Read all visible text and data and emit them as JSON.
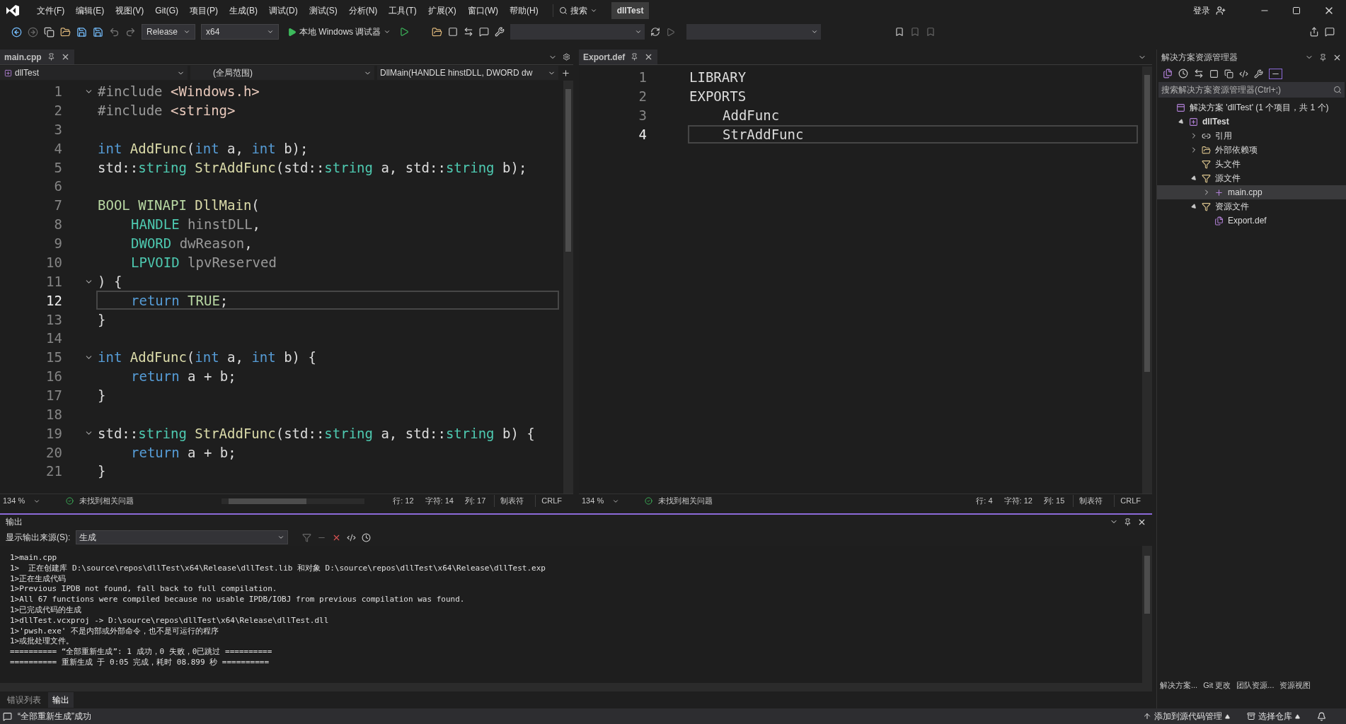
{
  "menu": [
    "文件(F)",
    "编辑(E)",
    "视图(V)",
    "Git(G)",
    "项目(P)",
    "生成(B)",
    "调试(D)",
    "测试(S)",
    "分析(N)",
    "工具(T)",
    "扩展(X)",
    "窗口(W)",
    "帮助(H)"
  ],
  "search": "搜索",
  "solution_badge": "dllTest",
  "account": "登录",
  "toolbar": {
    "configuration": "Release",
    "platform": "x64",
    "debugger": "本地 Windows 调试器"
  },
  "editors": [
    {
      "tab": "main.cpp",
      "nav": [
        "dllTest",
        "(全局范围)",
        "DllMain(HANDLE hinstDLL, DWORD dw"
      ],
      "lines": [
        {
          "number": "1",
          "fold": true,
          "current": false,
          "indented": false,
          "tokens": [
            {
              "text": "#include",
              "kind": "pre"
            },
            {
              "text": " <Windows.h>",
              "kind": "str"
            }
          ]
        },
        {
          "number": "2",
          "fold": false,
          "current": false,
          "indented": false,
          "tokens": [
            {
              "text": "#include",
              "kind": "pre"
            },
            {
              "text": " <string>",
              "kind": "str"
            }
          ]
        },
        {
          "number": "3",
          "fold": false,
          "current": false
        },
        {
          "number": "4",
          "fold": false,
          "current": false,
          "indented": false,
          "tokens": [
            {
              "text": "int",
              "kind": "kw"
            },
            {
              "text": " AddFunc",
              "kind": "fn"
            },
            {
              "text": "(",
              "kind": "plain"
            },
            {
              "text": "int",
              "kind": "kw"
            },
            {
              "text": " a, ",
              "kind": "plain"
            },
            {
              "text": "int",
              "kind": "kw"
            },
            {
              "text": " b);",
              "kind": "plain"
            }
          ]
        },
        {
          "number": "5",
          "fold": false,
          "current": false,
          "indented": false,
          "tokens": [
            {
              "text": "std::",
              "kind": "plain"
            },
            {
              "text": "string",
              "kind": "type"
            },
            {
              "text": " StrAddFunc",
              "kind": "fn"
            },
            {
              "text": "(std::",
              "kind": "plain"
            },
            {
              "text": "string",
              "kind": "type"
            },
            {
              "text": " a, std::",
              "kind": "plain"
            },
            {
              "text": "string",
              "kind": "type"
            },
            {
              "text": " b);",
              "kind": "plain"
            }
          ]
        },
        {
          "number": "6",
          "fold": false,
          "current": false
        },
        {
          "number": "7",
          "fold": false,
          "current": false,
          "indented": false,
          "tokens": [
            {
              "text": "BOOL",
              "kind": "macro"
            },
            {
              "text": " WINAPI",
              "kind": "macro"
            },
            {
              "text": " DllMain",
              "kind": "fn"
            },
            {
              "text": "(",
              "kind": "plain"
            }
          ]
        },
        {
          "number": "8",
          "fold": false,
          "current": false,
          "indented": true,
          "tokens": [
            {
              "text": "HANDLE",
              "kind": "type"
            },
            {
              "text": " hinstDLL",
              "kind": "param"
            },
            {
              "text": ",",
              "kind": "plain"
            }
          ]
        },
        {
          "number": "9",
          "fold": false,
          "current": false,
          "indented": true,
          "tokens": [
            {
              "text": "DWORD",
              "kind": "type"
            },
            {
              "text": " dwReason",
              "kind": "param"
            },
            {
              "text": ",",
              "kind": "plain"
            }
          ]
        },
        {
          "number": "10",
          "fold": false,
          "current": false,
          "indented": true,
          "tokens": [
            {
              "text": "LPVOID",
              "kind": "type"
            },
            {
              "text": " lpvReserved",
              "kind": "param"
            }
          ]
        },
        {
          "number": "11",
          "fold": true,
          "current": false,
          "indented": false,
          "tokens": [
            {
              "text": ") {",
              "kind": "plain"
            }
          ]
        },
        {
          "number": "12",
          "fold": false,
          "current": true,
          "indented": true,
          "tokens": [
            {
              "text": "return",
              "kind": "kw"
            },
            {
              "text": " TRUE",
              "kind": "macro"
            },
            {
              "text": ";",
              "kind": "plain"
            }
          ]
        },
        {
          "number": "13",
          "fold": false,
          "current": false,
          "indented": false,
          "tokens": [
            {
              "text": "}",
              "kind": "plain"
            }
          ]
        },
        {
          "number": "14",
          "fold": false,
          "current": false
        },
        {
          "number": "15",
          "fold": true,
          "current": false,
          "indented": false,
          "tokens": [
            {
              "text": "int",
              "kind": "kw"
            },
            {
              "text": " AddFunc",
              "kind": "fn"
            },
            {
              "text": "(",
              "kind": "plain"
            },
            {
              "text": "int",
              "kind": "kw"
            },
            {
              "text": " a, ",
              "kind": "plain"
            },
            {
              "text": "int",
              "kind": "kw"
            },
            {
              "text": " b) {",
              "kind": "plain"
            }
          ]
        },
        {
          "number": "16",
          "fold": false,
          "current": false,
          "indented": true,
          "tokens": [
            {
              "text": "return",
              "kind": "kw"
            },
            {
              "text": " a + b;",
              "kind": "plain"
            }
          ]
        },
        {
          "number": "17",
          "fold": false,
          "current": false,
          "indented": false,
          "tokens": [
            {
              "text": "}",
              "kind": "plain"
            }
          ]
        },
        {
          "number": "18",
          "fold": false,
          "current": false
        },
        {
          "number": "19",
          "fold": true,
          "current": false,
          "indented": false,
          "tokens": [
            {
              "text": "std::",
              "kind": "plain"
            },
            {
              "text": "string",
              "kind": "type"
            },
            {
              "text": " StrAddFunc",
              "kind": "fn"
            },
            {
              "text": "(std::",
              "kind": "plain"
            },
            {
              "text": "string",
              "kind": "type"
            },
            {
              "text": " a, std::",
              "kind": "plain"
            },
            {
              "text": "string",
              "kind": "type"
            },
            {
              "text": " b) {",
              "kind": "plain"
            }
          ]
        },
        {
          "number": "20",
          "fold": false,
          "current": false,
          "indented": true,
          "tokens": [
            {
              "text": "return",
              "kind": "kw"
            },
            {
              "text": " a + b;",
              "kind": "plain"
            }
          ]
        },
        {
          "number": "21",
          "fold": false,
          "current": false,
          "indented": false,
          "tokens": [
            {
              "text": "}",
              "kind": "plain"
            }
          ]
        }
      ],
      "status": {
        "zoom": "134 %",
        "issues": "未找到相关问题",
        "position": [
          "行: 12",
          "字符: 14",
          "列: 17"
        ],
        "indent": "制表符",
        "eol": "CRLF"
      }
    },
    {
      "tab": "Export.def",
      "lines": [
        {
          "number": "1",
          "fold": false,
          "current": false,
          "indented": false,
          "tokens": [
            {
              "text": "LIBRARY",
              "kind": "plain"
            }
          ]
        },
        {
          "number": "2",
          "fold": false,
          "current": false,
          "indented": false,
          "tokens": [
            {
              "text": "EXPORTS",
              "kind": "plain"
            }
          ]
        },
        {
          "number": "3",
          "fold": false,
          "current": false,
          "indented": true,
          "tokens": [
            {
              "text": "AddFunc",
              "kind": "plain"
            }
          ]
        },
        {
          "number": "4",
          "fold": false,
          "current": true,
          "indented": true,
          "tokens": [
            {
              "text": "StrAddFunc",
              "kind": "plain"
            }
          ]
        }
      ],
      "status": {
        "zoom": "134 %",
        "issues": "未找到相关问题",
        "position": [
          "行: 4",
          "字符: 12",
          "列: 15"
        ],
        "indent": "制表符",
        "eol": "CRLF"
      }
    }
  ],
  "solution_explorer": {
    "title": "解决方案资源管理器",
    "placeholder": "搜索解决方案资源管理器(Ctrl+;)",
    "tree": [
      {
        "label": "解决方案 'dllTest' (1 个项目，共 1 个)",
        "kind": "solution",
        "selected": false,
        "children": [
          {
            "label": "dllTest",
            "kind": "project",
            "expanded": true,
            "selected": false,
            "children": [
              {
                "label": "引用",
                "kind": "reference",
                "expanded": false,
                "selected": false
              },
              {
                "label": "外部依赖项",
                "kind": "external",
                "expanded": false,
                "selected": false
              },
              {
                "label": "头文件",
                "kind": "filter",
                "selected": false
              },
              {
                "label": "源文件",
                "kind": "filter",
                "expanded": true,
                "selected": false,
                "children": [
                  {
                    "label": "main.cpp",
                    "kind": "cpp",
                    "expanded": false,
                    "selected": true
                  }
                ]
              },
              {
                "label": "资源文件",
                "kind": "filter",
                "expanded": true,
                "selected": false,
                "children": [
                  {
                    "label": "Export.def",
                    "kind": "def",
                    "selected": false
                  }
                ]
              }
            ]
          }
        ]
      }
    ],
    "tabs": [
      "解决方案...",
      "Git 更改",
      "团队资源...",
      "资源视图"
    ]
  },
  "output": {
    "title": "输出",
    "source_label": "显示输出来源(S):",
    "source": "生成",
    "lines": [
      "1>main.cpp",
      "1>  正在创建库 D:\\source\\repos\\dllTest\\x64\\Release\\dllTest.lib 和对象 D:\\source\\repos\\dllTest\\x64\\Release\\dllTest.exp",
      "1>正在生成代码",
      "1>Previous IPDB not found, fall back to full compilation.",
      "1>All 67 functions were compiled because no usable IPDB/IOBJ from previous compilation was found.",
      "1>已完成代码的生成",
      "1>dllTest.vcxproj -> D:\\source\\repos\\dllTest\\x64\\Release\\dllTest.dll",
      "1>'pwsh.exe' 不是内部或外部命令，也不是可运行的程序",
      "1>或批处理文件。",
      "========== “全部重新生成”: 1 成功，0 失败，0已跳过 ==========",
      "========== 重新生成 于 0:05 完成，耗时 08.899 秒 =========="
    ]
  },
  "bottom_tabs": [
    {
      "label": "错误列表",
      "selected": false
    },
    {
      "label": "输出",
      "selected": true
    }
  ],
  "status_bar": {
    "message": "“全部重新生成”成功",
    "source_control": "添加到源代码管理",
    "repository": "选择仓库"
  }
}
